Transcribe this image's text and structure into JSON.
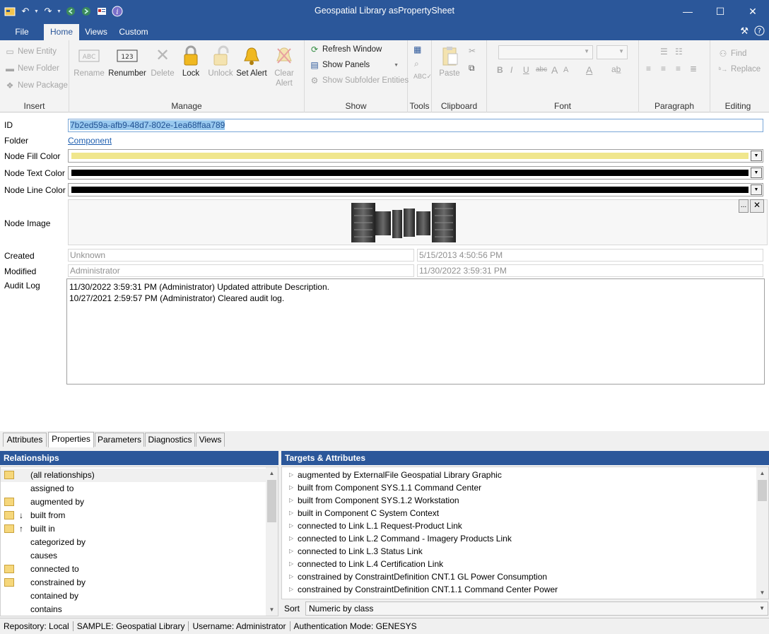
{
  "window": {
    "title": "Geospatial Library asPropertySheet",
    "qat_icons": [
      "app-icon",
      "undo-icon",
      "redo-icon",
      "back-icon",
      "forward-icon",
      "view-icon",
      "help-icon"
    ],
    "controls": {
      "minimize": "—",
      "maximize": "☐",
      "close": "✕"
    }
  },
  "ribbon_tabs": [
    "File",
    "Home",
    "Views",
    "Custom"
  ],
  "ribbon_tab_active": "Home",
  "ribbon": {
    "insert": {
      "label": "Insert",
      "new_entity": "New Entity",
      "new_folder": "New Folder",
      "new_package": "New Package"
    },
    "manage": {
      "label": "Manage",
      "rename": "Rename",
      "renumber": "Renumber",
      "delete": "Delete",
      "lock": "Lock",
      "unlock": "Unlock",
      "set_alert": "Set Alert",
      "clear_alert": "Clear Alert"
    },
    "show": {
      "label": "Show",
      "refresh_window": "Refresh Window",
      "show_panels": "Show Panels",
      "show_subfolder": "Show Subfolder Entities"
    },
    "tools": {
      "label": "Tools"
    },
    "clipboard": {
      "label": "Clipboard",
      "paste": "Paste"
    },
    "font": {
      "label": "Font",
      "bold": "B",
      "italic": "I",
      "underline": "U",
      "strike": "abc",
      "grow": "A",
      "shrink": "A",
      "color": "A"
    },
    "paragraph": {
      "label": "Paragraph"
    },
    "editing": {
      "label": "Editing",
      "find": "Find",
      "replace": "Replace"
    }
  },
  "form": {
    "id_label": "ID",
    "id_value": "7b2ed59a-afb9-48d7-802e-1ea68ffaa789",
    "folder_label": "Folder",
    "folder_value": "Component",
    "fill_label": "Node Fill Color",
    "fill_color": "#f0e68c",
    "text_label": "Node Text Color",
    "text_color": "#000000",
    "line_label": "Node Line Color",
    "line_color": "#000000",
    "image_label": "Node Image",
    "image_browse": "...",
    "image_clear": "✕",
    "created_label": "Created",
    "created_by": "Unknown",
    "created_date": "5/15/2013 4:50:56 PM",
    "modified_label": "Modified",
    "modified_by": "Administrator",
    "modified_date": "11/30/2022 3:59:31 PM",
    "audit_label": "Audit Log",
    "audit_log": [
      "11/30/2022 3:59:31 PM (Administrator) Updated attribute Description.",
      "10/27/2021 2:59:57 PM (Administrator) Cleared audit log."
    ]
  },
  "bottom_tabs": [
    "Attributes",
    "Properties",
    "Parameters",
    "Diagnostics",
    "Views"
  ],
  "bottom_tab_active": "Properties",
  "relationships": {
    "header": "Relationships",
    "items": [
      {
        "label": "(all relationships)",
        "folder": true,
        "arrow": ""
      },
      {
        "label": "assigned to",
        "folder": false,
        "arrow": ""
      },
      {
        "label": "augmented by",
        "folder": true,
        "arrow": ""
      },
      {
        "label": "built from",
        "folder": true,
        "arrow": "↓"
      },
      {
        "label": "built in",
        "folder": true,
        "arrow": "↑"
      },
      {
        "label": "categorized by",
        "folder": false,
        "arrow": ""
      },
      {
        "label": "causes",
        "folder": false,
        "arrow": ""
      },
      {
        "label": "connected to",
        "folder": true,
        "arrow": ""
      },
      {
        "label": "constrained by",
        "folder": true,
        "arrow": ""
      },
      {
        "label": "contained by",
        "folder": false,
        "arrow": ""
      },
      {
        "label": "contains",
        "folder": false,
        "arrow": ""
      }
    ]
  },
  "targets": {
    "header": "Targets & Attributes",
    "items": [
      "augmented by ExternalFile  Geospatial Library Graphic",
      "built from Component SYS.1.1 Command Center",
      "built from Component SYS.1.2 Workstation",
      "built in Component C System Context",
      "connected to Link L.1 Request-Product Link",
      "connected to Link L.2 Command - Imagery Products Link",
      "connected to Link L.3 Status Link",
      "connected to Link L.4 Certification Link",
      "constrained by ConstraintDefinition CNT.1 GL Power Consumption",
      "constrained by ConstraintDefinition CNT.1.1 Command Center Power"
    ],
    "sort_label": "Sort",
    "sort_value": "Numeric by class"
  },
  "status": [
    "Repository: Local",
    "SAMPLE: Geospatial Library",
    "Username: Administrator",
    "Authentication Mode: GENESYS"
  ]
}
